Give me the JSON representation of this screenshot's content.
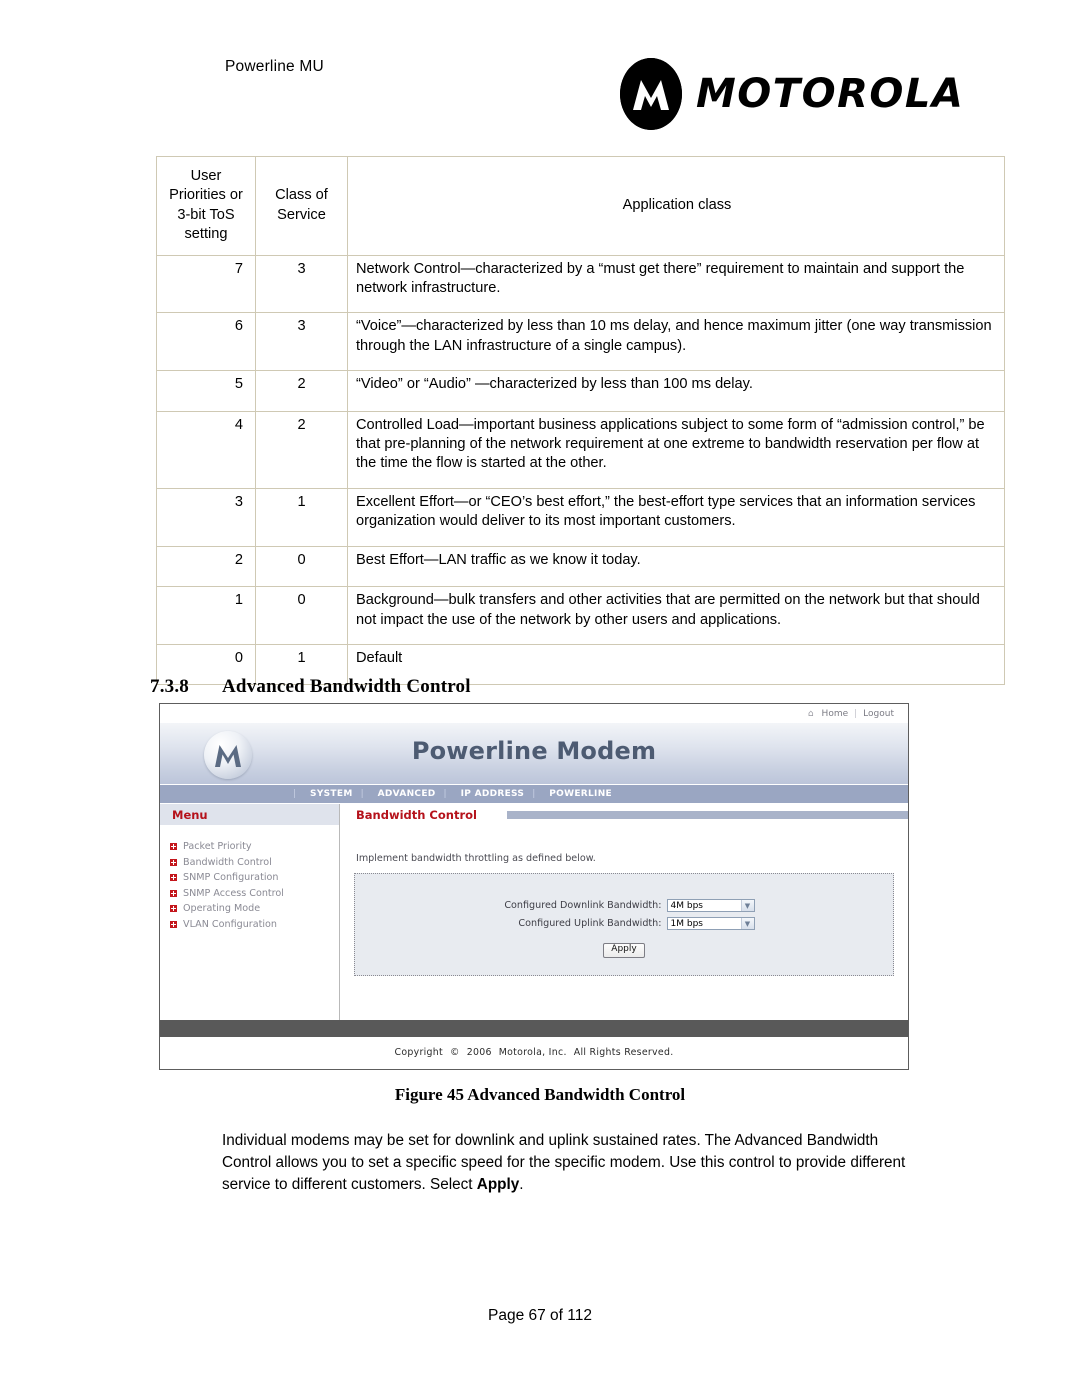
{
  "page_header": {
    "doc_title": "Powerline MU",
    "brand_wordmark": "MOTOROLA",
    "brand_mark_icon": "motorola-m-logo"
  },
  "tos_table": {
    "columns": [
      "User Priorities or 3-bit ToS setting",
      "Class of Service",
      "Application class"
    ],
    "column_header_lines": {
      "priority": [
        "User",
        "Priorities or",
        "3-bit ToS",
        "setting"
      ],
      "cos": [
        "Class of",
        "Service"
      ],
      "app": [
        "Application class"
      ]
    },
    "rows": [
      {
        "priority": "7",
        "cos": "3",
        "application": "Network Control—characterized by a “must get there” requirement to maintain and support the network infrastructure."
      },
      {
        "priority": "6",
        "cos": "3",
        "application": "“Voice”—characterized by less than 10 ms delay, and hence maximum jitter (one way transmission through the LAN infrastructure of a single campus)."
      },
      {
        "priority": "5",
        "cos": "2",
        "application": "“Video” or “Audio” —characterized by less than 100 ms delay."
      },
      {
        "priority": "4",
        "cos": "2",
        "application": "Controlled Load—important business applications subject to some form of “admission control,” be that pre-planning of the network requirement at one extreme to bandwidth reservation per flow at the time the flow is started at the other."
      },
      {
        "priority": "3",
        "cos": "1",
        "application": "Excellent Effort—or “CEO’s best effort,” the best-effort type services that an information services organization would deliver to its most important customers."
      },
      {
        "priority": "2",
        "cos": "0",
        "application": "Best Effort—LAN traffic as we know it today."
      },
      {
        "priority": "1",
        "cos": "0",
        "application": "Background—bulk transfers and other activities that are permitted on the network but that should not impact the use of the network by other users and applications."
      },
      {
        "priority": "0",
        "cos": "1",
        "application": "Default"
      }
    ]
  },
  "section": {
    "number": "7.3.8",
    "title": "Advanced Bandwidth Control"
  },
  "web_ui": {
    "topbar": {
      "home_icon": "home-icon",
      "home_label": "Home",
      "separator": "|",
      "logout_label": "Logout"
    },
    "banner": {
      "logo_icon": "motorola-m-logo",
      "title": "Powerline Modem"
    },
    "nav": {
      "items": [
        "SYSTEM",
        "ADVANCED",
        "IP ADDRESS",
        "POWERLINE"
      ],
      "separator": "|"
    },
    "sidebar": {
      "heading": "Menu",
      "items": [
        "Packet Priority",
        "Bandwidth Control",
        "SNMP Configuration",
        "SNMP Access Control",
        "Operating Mode",
        "VLAN Configuration"
      ]
    },
    "main": {
      "title": "Bandwidth Control",
      "intro": "Implement bandwidth throttling as defined below.",
      "fields": [
        {
          "label": "Configured Downlink Bandwidth:",
          "value": "4M bps"
        },
        {
          "label": "Configured Uplink Bandwidth:",
          "value": "1M bps"
        }
      ],
      "apply_label": "Apply"
    },
    "footer": {
      "copyright_word": "Copyright",
      "copyright_symbol": "©",
      "year": "2006",
      "company": "Motorola, Inc.",
      "rights": "All Rights Reserved."
    }
  },
  "figure_caption": "Figure 45 Advanced Bandwidth Control",
  "body": {
    "paragraph_part1": "Individual modems may be set  for downlink and uplink sustained rates. The Advanced Bandwidth Control allows you to set a specific speed for the specific modem. Use this control to provide different service to different customers. Select ",
    "paragraph_bold": "Apply",
    "paragraph_part2": "."
  },
  "page_footer": "Page 67 of 112",
  "colors": {
    "brand_red": "#b5121b",
    "nav_blue": "#9aa6c2",
    "accent_bar": "#a9b3c9",
    "dark_bar": "#595959"
  }
}
